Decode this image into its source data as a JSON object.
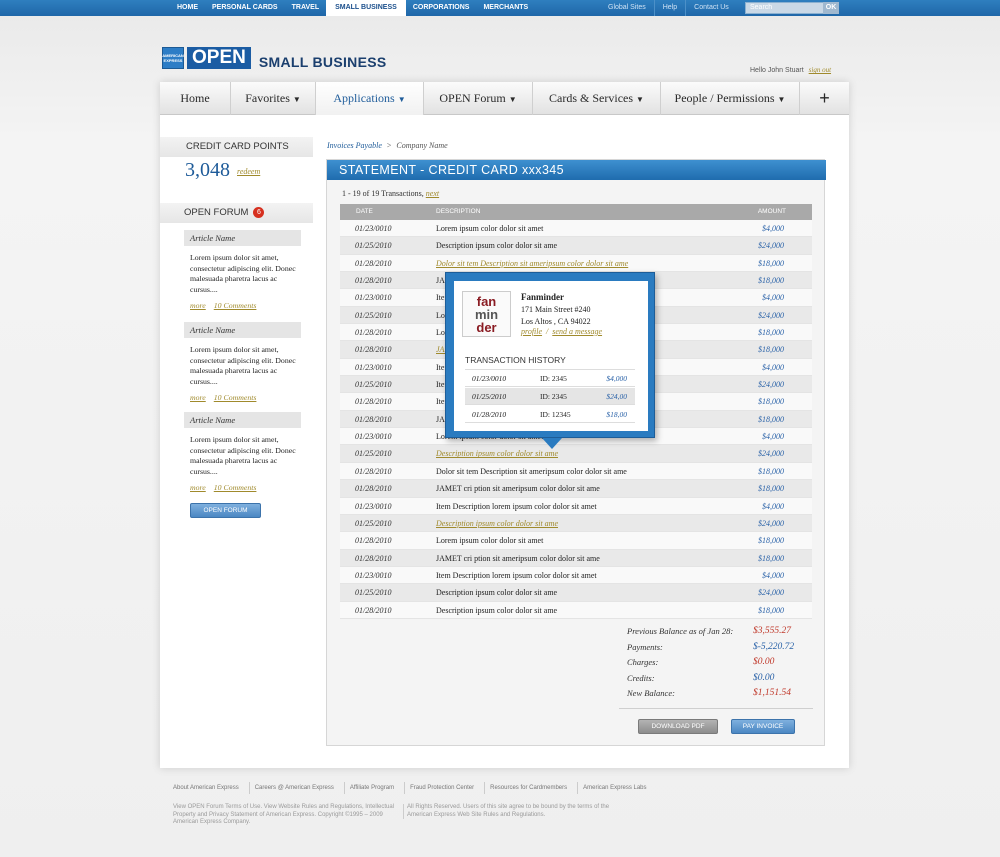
{
  "topbar": {
    "nav": [
      "Home",
      "Personal Cards",
      "Travel",
      "Small Business",
      "Corporations",
      "Merchants"
    ],
    "active_index": 3,
    "links": [
      "Global Sites",
      "Help",
      "Contact Us"
    ],
    "search_placeholder": "Search",
    "search_button": "OK"
  },
  "header": {
    "logo_open": "OPEN",
    "logo_small_business": "SMALL BUSINESS",
    "greeting": "Hello John Stuart",
    "sign_out": "sign out"
  },
  "mainnav": {
    "items": [
      {
        "label": "Home",
        "dropdown": false,
        "width": 71
      },
      {
        "label": "Favorites",
        "dropdown": true,
        "width": 85
      },
      {
        "label": "Applications",
        "dropdown": true,
        "width": 108
      },
      {
        "label": "OPEN Forum",
        "dropdown": true,
        "width": 109
      },
      {
        "label": "Cards & Services",
        "dropdown": true,
        "width": 128
      },
      {
        "label": "People / Permissions",
        "dropdown": true,
        "width": 139
      }
    ],
    "active_index": 2,
    "plus": "+"
  },
  "sidebar": {
    "points_title": "CREDIT CARD POINTS",
    "points_value": "3,048",
    "redeem": "redeem",
    "forum_title": "OPEN FORUM",
    "forum_badge": "6",
    "articles": [
      {
        "title": "Article Name",
        "body": "Lorem ipsum dolor sit amet, consectetur adipiscing elit. Donec malesuada pharetra lacus ac cursus....",
        "more": "more",
        "comments": "10 Comments"
      },
      {
        "title": "Article Name",
        "body": "Lorem ipsum dolor sit amet, consectetur adipiscing elit. Donec malesuada pharetra lacus ac cursus....",
        "more": "more",
        "comments": "10 Comments"
      },
      {
        "title": "Article Name",
        "body": "Lorem ipsum dolor sit amet, consectetur adipiscing elit. Donec malesuada pharetra lacus ac cursus....",
        "more": "more",
        "comments": "10 Comments"
      }
    ],
    "forum_button": "OPEN FORUM"
  },
  "breadcrumb": {
    "link": "Invoices Payable",
    "sep": ">",
    "current": "Company Name"
  },
  "statement": {
    "title": "STATEMENT - CREDIT CARD xxx345",
    "count": "1 - 19 of 19 Transactions,",
    "next": "next",
    "headers": {
      "date": "DATE",
      "description": "DESCRIPTION",
      "amount": "AMOUNT"
    },
    "rows": [
      {
        "date": "01/23/0010",
        "desc": "Lorem ipsum color dolor sit amet",
        "amount": "$4,000",
        "link": false
      },
      {
        "date": "01/25/2010",
        "desc": "Description ipsum color dolor sit ame",
        "amount": "$24,000",
        "link": false
      },
      {
        "date": "01/28/2010",
        "desc": "Dolor sit tem Description sit ameripsum color dolor sit ame",
        "amount": "$18,000",
        "link": true
      },
      {
        "date": "01/28/2010",
        "desc": "JAMET cri ption sit ameripsum color dolor sit ame",
        "amount": "$18,000",
        "link": false
      },
      {
        "date": "01/23/0010",
        "desc": "Item Description lorem ipsum color dolor sit amet",
        "amount": "$4,000",
        "link": false
      },
      {
        "date": "01/25/2010",
        "desc": "Lorem ipsum color dolor sit ame",
        "amount": "$24,000",
        "link": false
      },
      {
        "date": "01/28/2010",
        "desc": "Lorem ipsum color dolor sit amet",
        "amount": "$18,000",
        "link": false
      },
      {
        "date": "01/28/2010",
        "desc": "JAMET cri ption sit ameripsum color dolor sit ame",
        "amount": "$18,000",
        "link": true
      },
      {
        "date": "01/23/0010",
        "desc": "Item Description lorem ipsum color dolor sit amet",
        "amount": "$4,000",
        "link": false
      },
      {
        "date": "01/25/2010",
        "desc": "Item Description ipsum color dolor sit ame",
        "amount": "$24,000",
        "link": false
      },
      {
        "date": "01/28/2010",
        "desc": "Item Description lorem ipsum color dolor sit amet",
        "amount": "$18,000",
        "link": false
      },
      {
        "date": "01/28/2010",
        "desc": "JAMET cri ption sit ameripsum color dolor sit ame",
        "amount": "$18,000",
        "link": false
      },
      {
        "date": "01/23/0010",
        "desc": "Lorem ipsum color dolor sit amet",
        "amount": "$4,000",
        "link": false
      },
      {
        "date": "01/25/2010",
        "desc": "Description ipsum color dolor sit ame",
        "amount": "$24,000",
        "link": true
      },
      {
        "date": "01/28/2010",
        "desc": "Dolor sit tem Description sit ameripsum color dolor sit ame",
        "amount": "$18,000",
        "link": false
      },
      {
        "date": "01/28/2010",
        "desc": "JAMET cri ption sit ameripsum color dolor sit ame",
        "amount": "$18,000",
        "link": false
      },
      {
        "date": "01/23/0010",
        "desc": "Item Description lorem ipsum color dolor sit amet",
        "amount": "$4,000",
        "link": false
      },
      {
        "date": "01/25/2010",
        "desc": "Description ipsum color dolor sit ame",
        "amount": "$24,000",
        "link": true
      },
      {
        "date": "01/28/2010",
        "desc": "Lorem ipsum color dolor sit amet",
        "amount": "$18,000",
        "link": false
      },
      {
        "date": "01/28/2010",
        "desc": "JAMET cri ption sit ameripsum color dolor sit ame",
        "amount": "$18,000",
        "link": false
      },
      {
        "date": "01/23/0010",
        "desc": "Item Description lorem ipsum color dolor sit amet",
        "amount": "$4,000",
        "link": false
      },
      {
        "date": "01/25/2010",
        "desc": "Description ipsum color dolor sit ame",
        "amount": "$24,000",
        "link": false
      },
      {
        "date": "01/28/2010",
        "desc": "Description ipsum color dolor sit ame",
        "amount": "$18,000",
        "link": false
      }
    ],
    "summary": [
      {
        "label": "Previous Balance as of Jan 28:",
        "value": "$3,555.27",
        "color": "#c0392b"
      },
      {
        "label": "Payments:",
        "value": "$-5,220.72",
        "color": "#2a62a8"
      },
      {
        "label": "Charges:",
        "value": "$0.00",
        "color": "#c0392b"
      },
      {
        "label": "Credits:",
        "value": "$0.00",
        "color": "#2a62a8"
      },
      {
        "label": "New Balance:",
        "value": "$1,151.54",
        "color": "#c0392b"
      }
    ],
    "download": "DOWNLOAD PDF",
    "pay": "PAY INVOICE"
  },
  "popup": {
    "logo_lines": [
      "fan",
      "min",
      "der"
    ],
    "name": "Fanminder",
    "address1": "171 Main Street #240",
    "address2": "Los Altos , CA 94022",
    "profile": "profile",
    "slash": "/",
    "message": "send a message",
    "history_title": "TRANSACTION HISTORY",
    "history": [
      {
        "date": "01/23/0010",
        "id": "ID: 2345",
        "amount": "$4,000"
      },
      {
        "date": "01/25/2010",
        "id": "ID: 2345",
        "amount": "$24,00"
      },
      {
        "date": "01/28/2010",
        "id": "ID: 12345",
        "amount": "$18,00"
      }
    ]
  },
  "footer": {
    "links": [
      "About American Express",
      "Careers @ American Express",
      "Affiliate Program",
      "Fraud Protection Center",
      "Resources for Cardmembers",
      "American Express Labs"
    ],
    "legal1": "View OPEN Forum Terms of Use. View Website Rules and Regulations, Intellectual Property and Privacy Statement of American Express. Copyright ©1995 – 2009 American Express Company.",
    "legal2": "All Rights Reserved. Users of this site agree to be bound by the terms of the American Express Web Site Rules and Regulations."
  },
  "colors": {
    "brand_blue": "#1f66a8",
    "link_gold": "#a08a2c",
    "amount_blue": "#2a62a8",
    "negative_red": "#c0392b"
  }
}
